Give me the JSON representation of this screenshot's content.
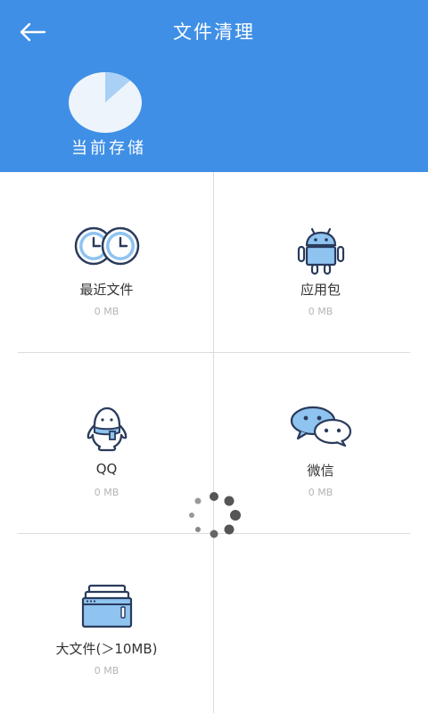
{
  "header": {
    "title": "文件清理",
    "storage_label": "当前存储",
    "storage_used_fraction": 0.12,
    "colors": {
      "bar": "#3f8fe6",
      "pie_free": "#eef4fb",
      "pie_used": "#a9d0f5"
    }
  },
  "categories": [
    {
      "name": "最近文件",
      "size": "0 MB",
      "icon": "clocks-icon"
    },
    {
      "name": "应用包",
      "size": "0 MB",
      "icon": "android-icon"
    },
    {
      "name": "QQ",
      "size": "0 MB",
      "icon": "qq-penguin-icon"
    },
    {
      "name": "微信",
      "size": "0 MB",
      "icon": "wechat-icon"
    },
    {
      "name": "大文件(＞10MB)",
      "size": "0 MB",
      "icon": "window-stack-icon"
    }
  ],
  "icons": {
    "back": "back-arrow-icon",
    "loading": "loading-spinner-icon"
  }
}
